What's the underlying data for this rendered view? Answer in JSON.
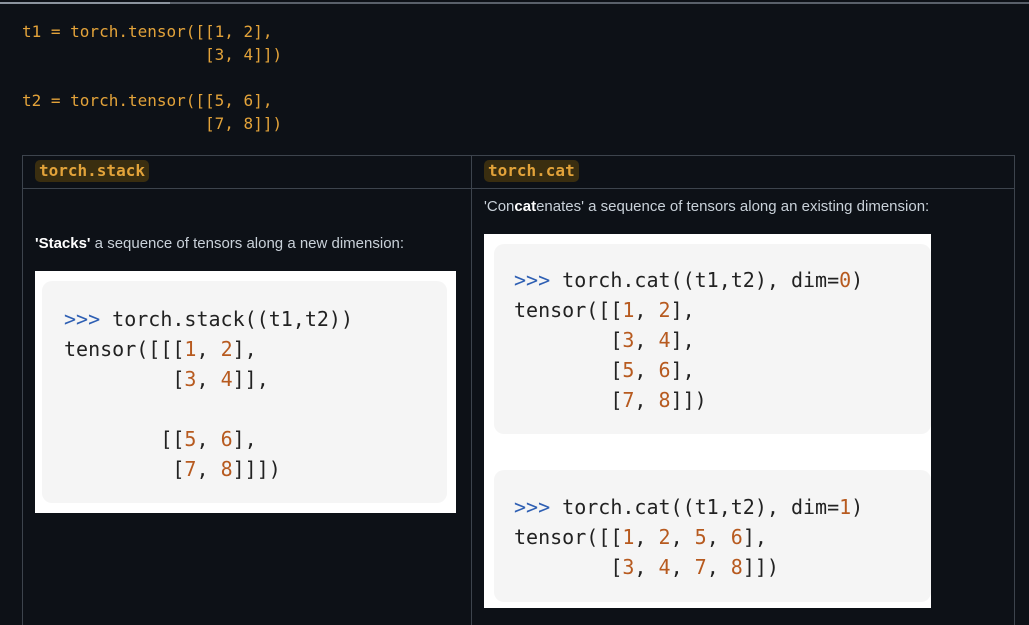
{
  "code": {
    "lines": [
      "t1 = torch.tensor([[1, 2],",
      "                   [3, 4]])",
      "",
      "t2 = torch.tensor([[5, 6],",
      "                   [7, 8]])"
    ]
  },
  "table": {
    "headers": [
      "torch.stack",
      "torch.cat"
    ],
    "stack": {
      "desc_bold": "'Stacks'",
      "desc_rest": " a sequence of tensors along a new dimension:",
      "snippet": {
        "prompt": ">>>",
        "call": " torch.stack((t1,t2))",
        "l2a": "tensor([[[",
        "v1": "1",
        "c1": ", ",
        "v2": "2",
        "l2b": "],",
        "l3a": "         [",
        "v3": "3",
        "c2": ", ",
        "v4": "4",
        "l3b": "]],",
        "l5a": "        [[",
        "v5": "5",
        "c3": ", ",
        "v6": "6",
        "l5b": "],",
        "l6a": "         [",
        "v7": "7",
        "c4": ", ",
        "v8": "8",
        "l6b": "]]])"
      }
    },
    "cat": {
      "desc_pre": "'Con",
      "desc_bold": "cat",
      "desc_rest": "enates' a sequence of tensors along an existing dimension:",
      "snippet0": {
        "prompt": ">>>",
        "call": " torch.cat((t1,t2), dim=",
        "dim": "0",
        "close": ")",
        "l2a": "tensor([[",
        "v1": "1",
        "c1": ", ",
        "v2": "2",
        "l2b": "],",
        "l3a": "        [",
        "v3": "3",
        "c2": ", ",
        "v4": "4",
        "l3b": "],",
        "l4a": "        [",
        "v5": "5",
        "c3": ", ",
        "v6": "6",
        "l4b": "],",
        "l5a": "        [",
        "v7": "7",
        "c4": ", ",
        "v8": "8",
        "l5b": "]])"
      },
      "snippet1": {
        "prompt": ">>>",
        "call": " torch.cat((t1,t2), dim=",
        "dim": "1",
        "close": ")",
        "l2a": "tensor([[",
        "v1": "1",
        "c1": ", ",
        "v2": "2",
        "c2": ", ",
        "v3": "5",
        "c3": ", ",
        "v4": "6",
        "l2b": "],",
        "l3a": "        [",
        "v5": "3",
        "c4": ", ",
        "v6": "4",
        "c5": ", ",
        "v7": "7",
        "c6": ", ",
        "v8": "8",
        "l3b": "]])"
      }
    }
  }
}
